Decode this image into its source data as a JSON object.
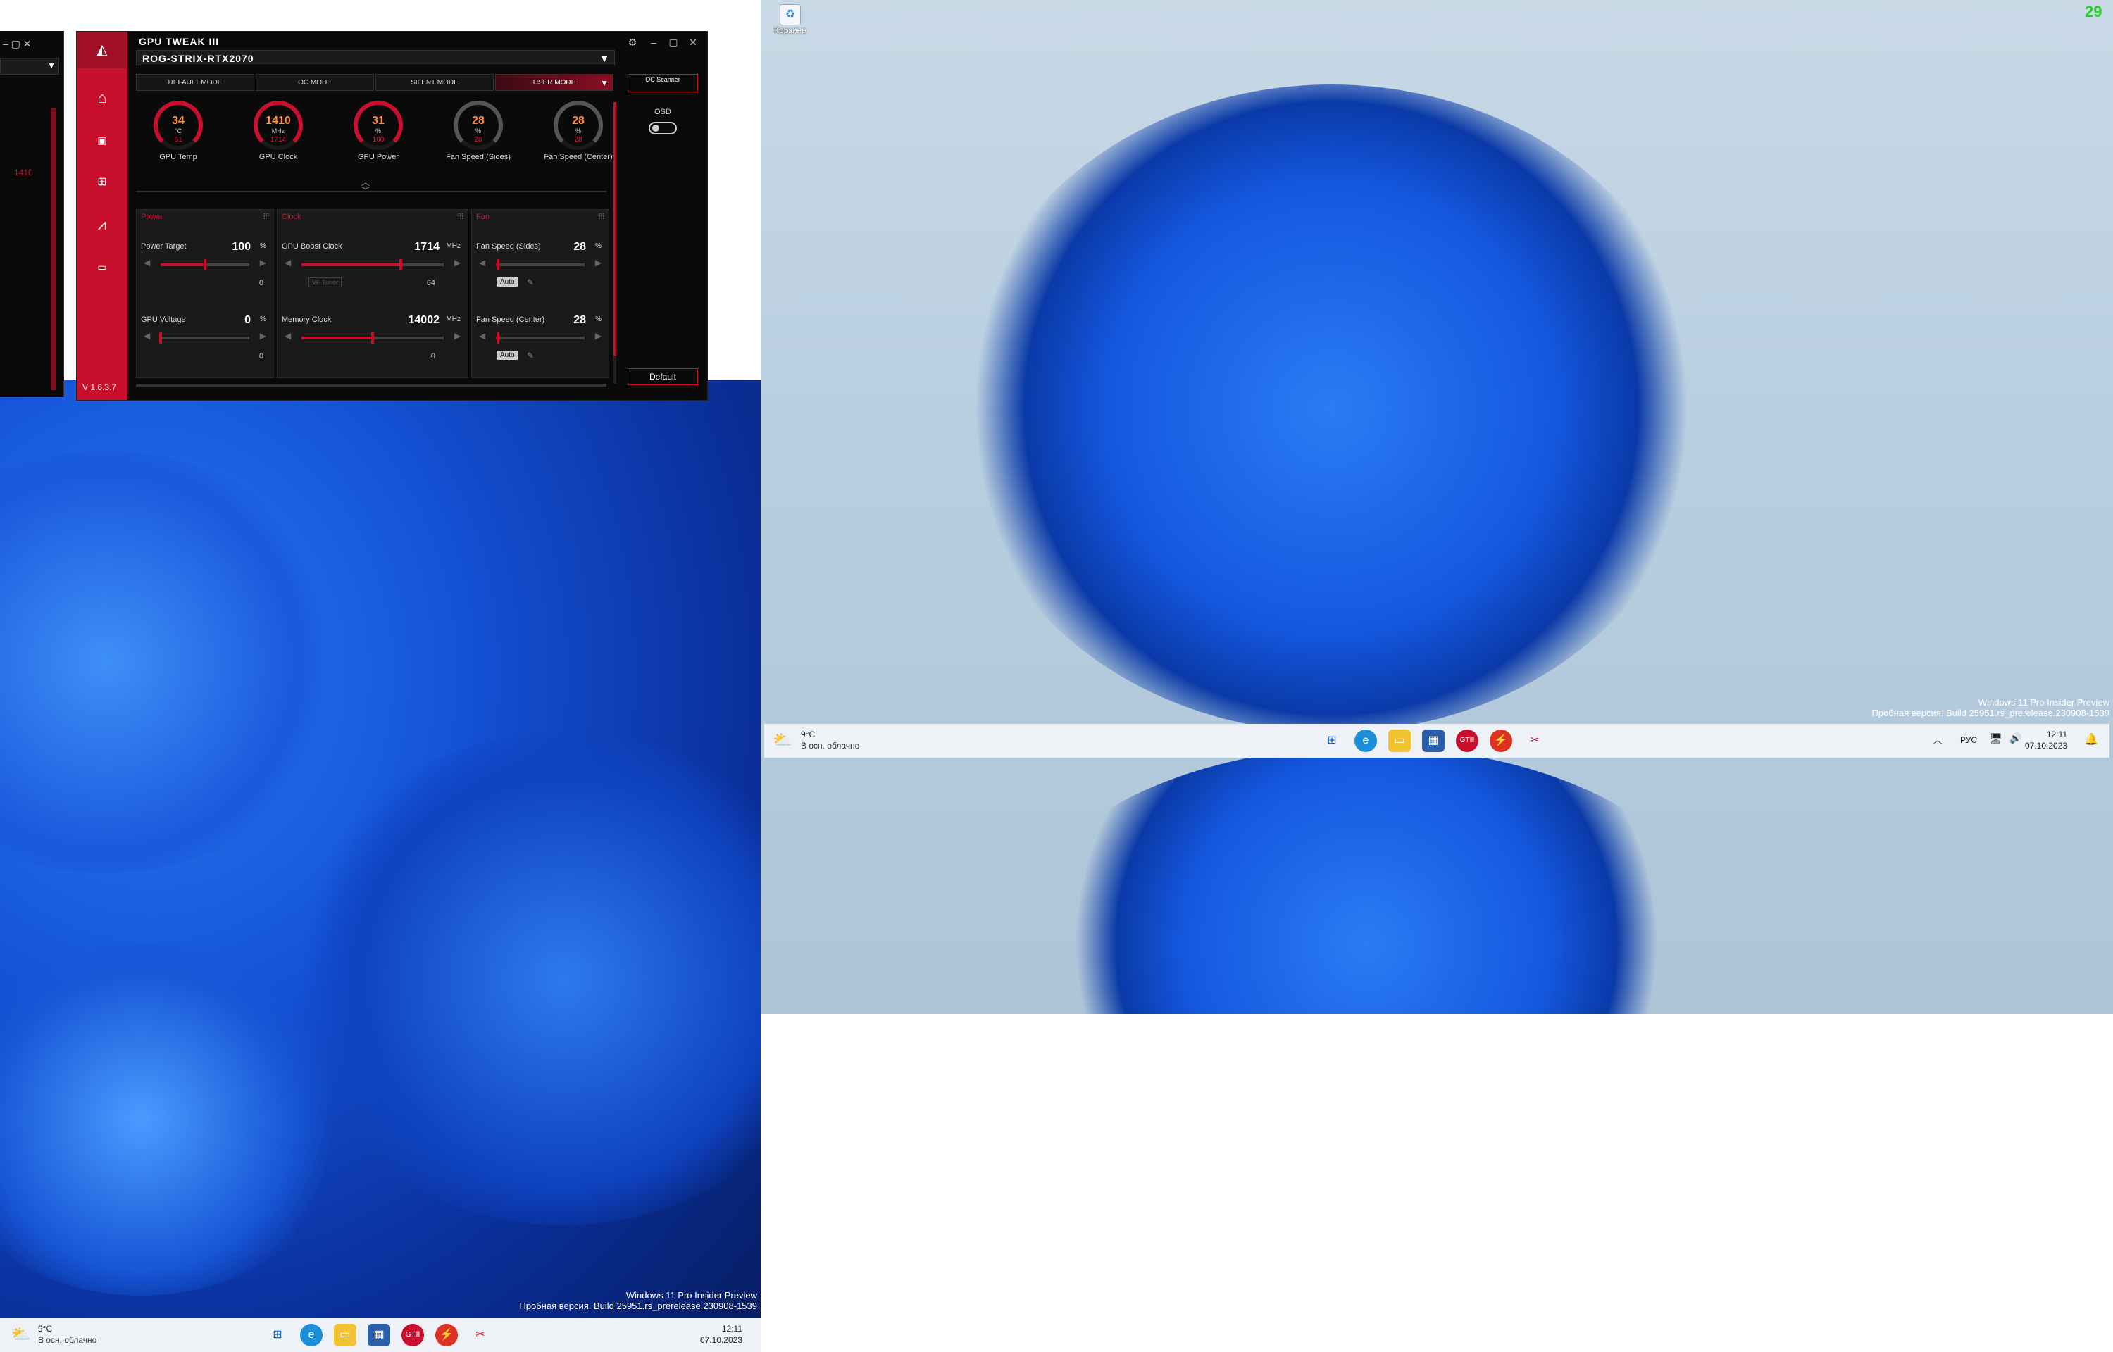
{
  "gpu_tweak": {
    "title": "GPU TWEAK III",
    "model": "ROG-STRIX-RTX2070",
    "version": "V 1.6.3.7",
    "tabs": [
      "DEFAULT MODE",
      "OC MODE",
      "SILENT MODE",
      "USER MODE"
    ],
    "active_tab": "USER MODE",
    "oc_scanner": "OC Scanner",
    "osd_label": "OSD",
    "default_button": "Default",
    "gauges": [
      {
        "label": "GPU Temp",
        "value": "34",
        "unit": "°C",
        "sub": "61"
      },
      {
        "label": "GPU Clock",
        "value": "1410",
        "unit": "MHz",
        "sub": "1714"
      },
      {
        "label": "GPU Power",
        "value": "31",
        "unit": "%",
        "sub": "100"
      },
      {
        "label": "Fan Speed (Sides)",
        "value": "28",
        "unit": "%",
        "sub": "28"
      },
      {
        "label": "Fan Speed (Center)",
        "value": "28",
        "unit": "%",
        "sub": "28"
      }
    ],
    "panels": {
      "power": {
        "title": "Power",
        "power_target": {
          "name": "Power Target",
          "value": "100",
          "unit": "%",
          "sub": "0",
          "fill": 0.5
        },
        "gpu_voltage": {
          "name": "GPU Voltage",
          "value": "0",
          "unit": "%",
          "sub": "0",
          "fill": 0.0
        }
      },
      "clock": {
        "title": "Clock",
        "boost": {
          "name": "GPU Boost Clock",
          "value": "1714",
          "unit": "MHz",
          "sub": "64",
          "fill": 0.7,
          "btn": "VF Tuner"
        },
        "memory": {
          "name": "Memory Clock",
          "value": "14002",
          "unit": "MHz",
          "sub": "0",
          "fill": 0.5
        }
      },
      "fan": {
        "title": "Fan",
        "sides": {
          "name": "Fan Speed (Sides)",
          "value": "28",
          "unit": "%",
          "auto": "Auto",
          "fill": 0.02
        },
        "center": {
          "name": "Fan Speed (Center)",
          "value": "28",
          "unit": "%",
          "auto": "Auto",
          "fill": 0.02
        }
      }
    }
  },
  "left_window": {
    "value_1410": "1410"
  },
  "desktop": {
    "counter": "29",
    "recycle_bin": "Корзина"
  },
  "watermark": {
    "line1": "Windows 11 Pro Insider Preview",
    "line2": "Пробная версия. Build 25951.rs_prerelease.230908-1539"
  },
  "taskbar": {
    "temp": "9°C",
    "condition": "В осн. облачно",
    "lang": "РУС",
    "time": "12:11",
    "date": "07.10.2023"
  },
  "colors": {
    "accent": "#c8102e",
    "gauge": "#ff8a3d"
  }
}
